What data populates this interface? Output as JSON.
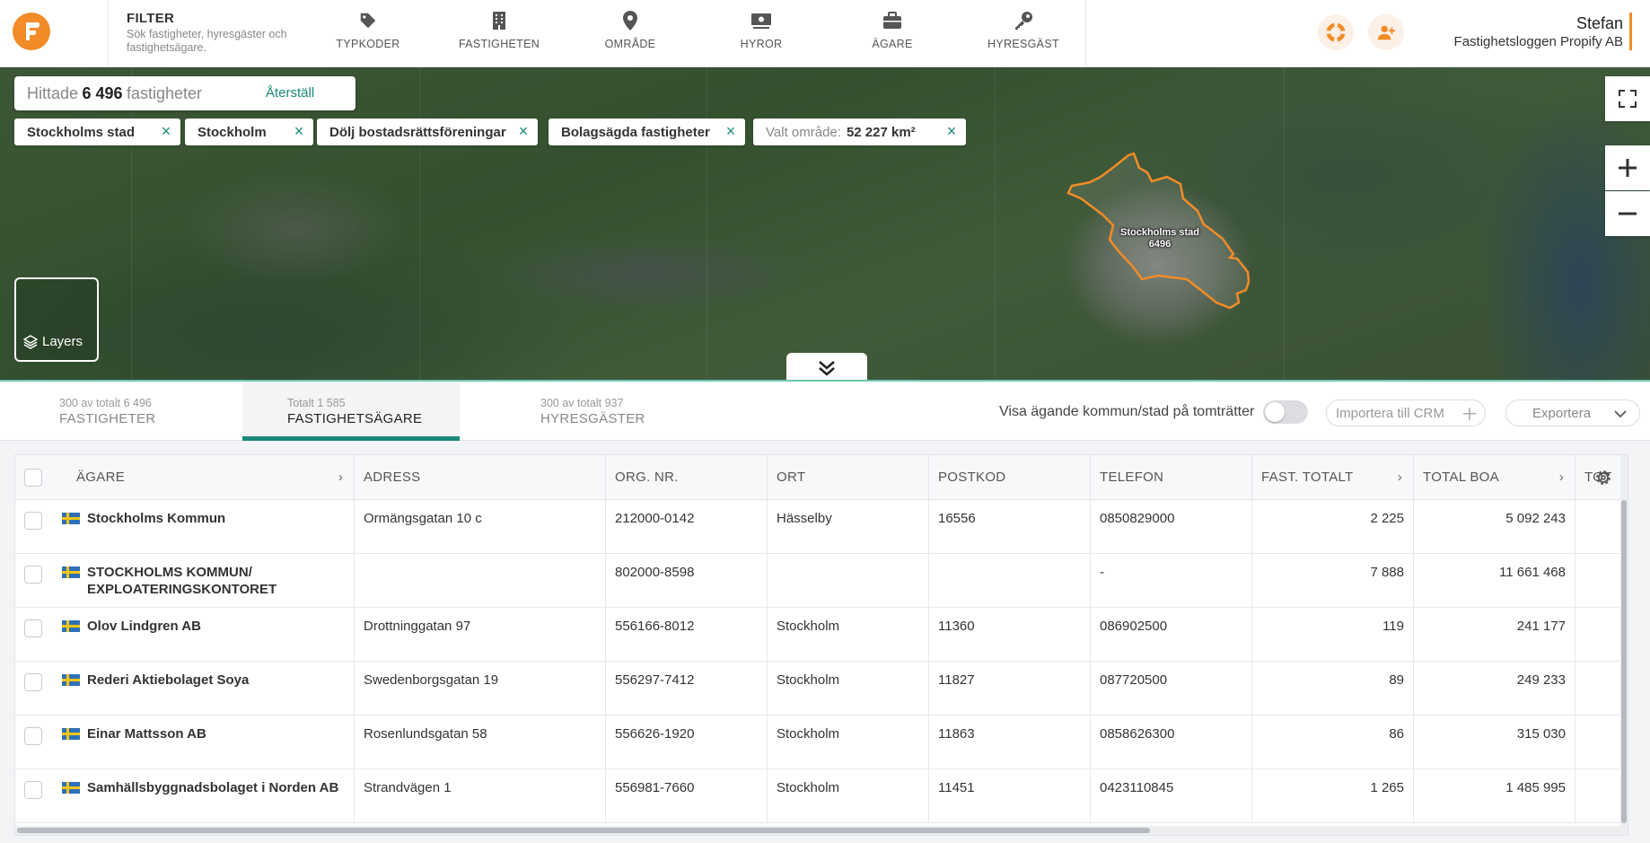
{
  "header": {
    "filter_title": "FILTER",
    "filter_desc": "Sök fastigheter, hyresgäster och fastighetsägare.",
    "nav": [
      {
        "label": "TYPKODER",
        "icon": "tag-icon"
      },
      {
        "label": "FASTIGHETEN",
        "icon": "building-icon"
      },
      {
        "label": "OMRÅDE",
        "icon": "map-pin-icon"
      },
      {
        "label": "HYROR",
        "icon": "money-icon"
      },
      {
        "label": "ÄGARE",
        "icon": "briefcase-icon"
      },
      {
        "label": "HYRESGÄST",
        "icon": "key-icon"
      }
    ],
    "user_name": "Stefan",
    "user_org": "Fastighetsloggen Propify AB",
    "accent_color": "#f28c28"
  },
  "map": {
    "found_prefix": "Hittade",
    "found_count": "6 496",
    "found_suffix": "fastigheter",
    "reset_label": "Återställ",
    "chips": [
      {
        "label": "Stockholms stad"
      },
      {
        "label": "Stockholm"
      },
      {
        "label": "Dölj bostadsrättsföreningar"
      },
      {
        "label": "Bolagsägda fastigheter"
      }
    ],
    "area_chip_label": "Valt område:",
    "area_chip_value": "52 227 km²",
    "region_name": "Stockholms stad",
    "region_count": "6496",
    "layers_label": "Layers"
  },
  "tabs": [
    {
      "sub": "300 av totalt 6 496",
      "label": "FASTIGHETER",
      "active": false
    },
    {
      "sub": "Totalt 1 585",
      "label": "FASTIGHETSÄGARE",
      "active": true
    },
    {
      "sub": "300 av totalt 937",
      "label": "HYRESGÄSTER",
      "active": false
    }
  ],
  "toolbar": {
    "toggle_label": "Visa ägande kommun/stad på tomträtter",
    "import_label": "Importera till CRM",
    "export_label": "Exportera"
  },
  "table": {
    "headers": [
      "ÄGARE",
      "ADRESS",
      "ORG. NR.",
      "ORT",
      "POSTKOD",
      "TELEFON",
      "FAST. TOTALT",
      "TOTAL BOA",
      "TOT"
    ],
    "rows": [
      {
        "owner": "Stockholms Kommun",
        "address": "Ormängsgatan 10 c",
        "org": "212000-0142",
        "city": "Hässelby",
        "zip": "16556",
        "phone": "0850829000",
        "fast": "2 225",
        "boa": "5 092 243"
      },
      {
        "owner": "STOCKHOLMS KOMMUN/ EXPLOATERINGSKONTORET",
        "address": "",
        "org": "802000-8598",
        "city": "",
        "zip": "",
        "phone": "-",
        "fast": "7 888",
        "boa": "11 661 468"
      },
      {
        "owner": "Olov Lindgren AB",
        "address": "Drottninggatan 97",
        "org": "556166-8012",
        "city": "Stockholm",
        "zip": "11360",
        "phone": "086902500",
        "fast": "119",
        "boa": "241 177"
      },
      {
        "owner": "Rederi Aktiebolaget Soya",
        "address": "Swedenborgsgatan 19",
        "org": "556297-7412",
        "city": "Stockholm",
        "zip": "11827",
        "phone": "087720500",
        "fast": "89",
        "boa": "249 233"
      },
      {
        "owner": "Einar Mattsson AB",
        "address": "Rosenlundsgatan 58",
        "org": "556626-1920",
        "city": "Stockholm",
        "zip": "11863",
        "phone": "0858626300",
        "fast": "86",
        "boa": "315 030"
      },
      {
        "owner": "Samhällsbyggnadsbolaget i Norden AB",
        "address": "Strandvägen 1",
        "org": "556981-7660",
        "city": "Stockholm",
        "zip": "11451",
        "phone": "0423110845",
        "fast": "1 265",
        "boa": "1 485 995"
      }
    ]
  }
}
